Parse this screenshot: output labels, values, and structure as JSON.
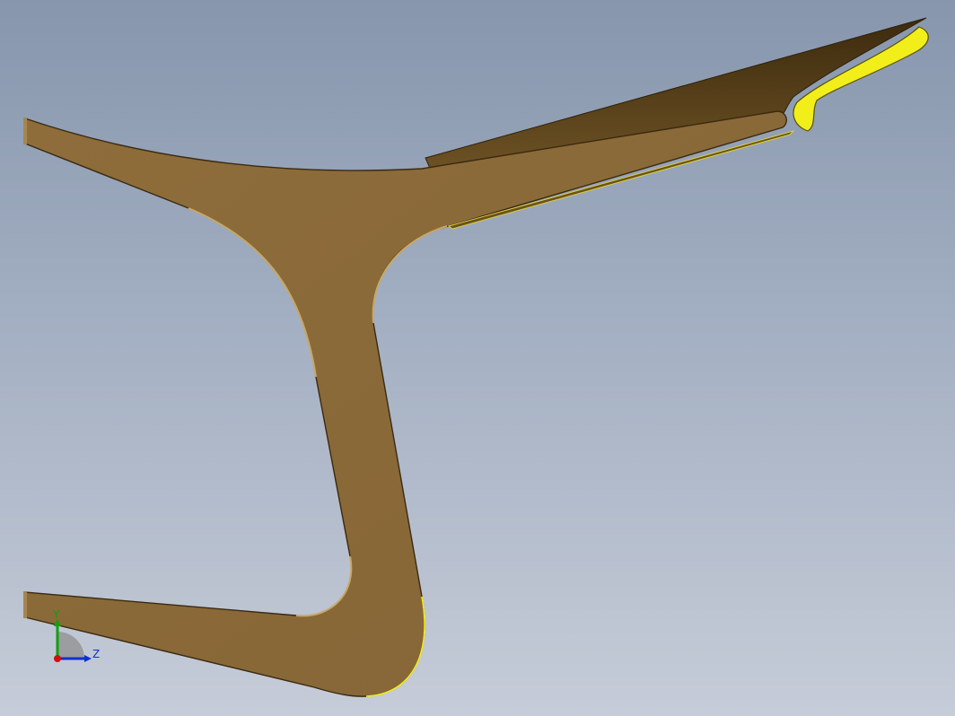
{
  "viewport": {
    "background_top": "#8796ad",
    "background_bottom": "#c6ccd8"
  },
  "model": {
    "part_color": "#8b6a39",
    "part_dark_color": "#4e3915",
    "highlight_color": "#f2ee1a",
    "edge_color": "#3a2a10"
  },
  "triad": {
    "y_label": "Y",
    "z_label": "Z",
    "y_color": "#10a010",
    "z_color": "#1030d0",
    "x_color": "#d01010"
  }
}
